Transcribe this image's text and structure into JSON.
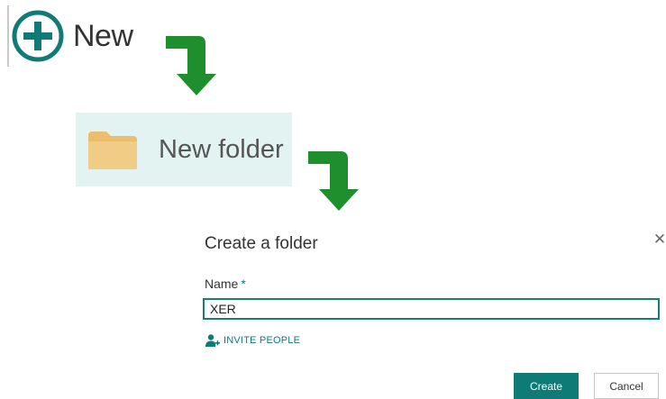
{
  "step1": {
    "label": "New",
    "icon": "plus-circle-icon",
    "accent_color": "#0f7b76"
  },
  "step2": {
    "label": "New folder",
    "icon": "folder-icon",
    "highlight_color": "#e3f3f1",
    "folder_color": "#f0c97c"
  },
  "arrows": {
    "icon": "bent-arrow-down-icon",
    "color": "#1f8f2e"
  },
  "dialog": {
    "title": "Create a folder",
    "close_glyph": "✕",
    "name_label": "Name",
    "required_marker": "*",
    "name_value": "XER",
    "invite_label": "INVITE PEOPLE",
    "create_label": "Create",
    "cancel_label": "Cancel",
    "accent_color": "#0f7b76"
  }
}
